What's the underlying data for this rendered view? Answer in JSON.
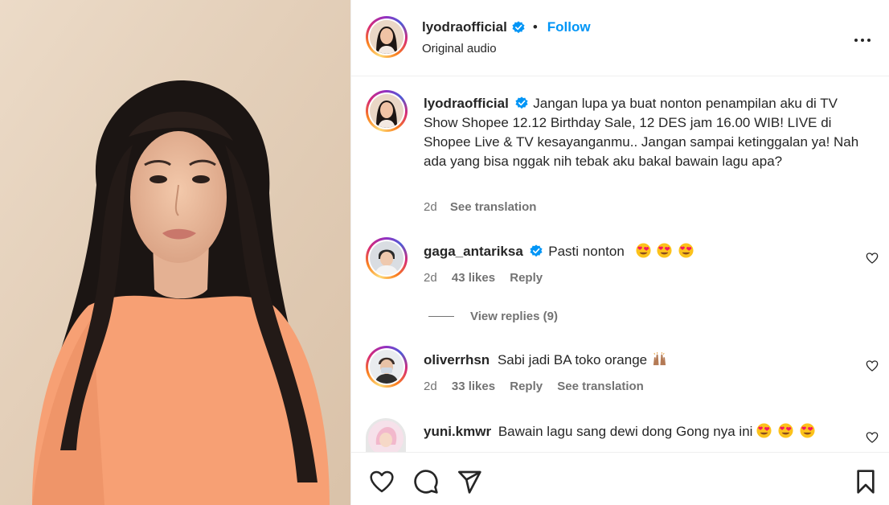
{
  "post": {
    "username": "lyodraofficial",
    "follow_label": "Follow",
    "separator": "•",
    "audio_label": "Original audio"
  },
  "caption": {
    "username": "lyodraofficial",
    "text": "Jangan lupa ya buat nonton penampilan aku di TV Show Shopee 12.12 Birthday Sale, 12 DES jam 16.00 WIB! LIVE di Shopee Live & TV kesayanganmu.. Jangan sampai ketinggalan ya! Nah ada yang bisa nggak nih tebak aku bakal bawain lagu apa?",
    "time": "2d",
    "translate": "See translation"
  },
  "comments": [
    {
      "username": "gaga_antariksa",
      "verified": true,
      "text": "Pasti nonton",
      "emoji": "heart-eyes x3",
      "time": "2d",
      "likes": "43 likes",
      "reply": "Reply",
      "view_replies": "View replies (9)"
    },
    {
      "username": "oliverrhsn",
      "verified": false,
      "text": "Sabi jadi BA toko orange",
      "emoji": "raising-hands",
      "time": "2d",
      "likes": "33 likes",
      "reply": "Reply",
      "translate": "See translation"
    },
    {
      "username": "yuni.kmwr",
      "verified": false,
      "text": "Bawain lagu sang dewi dong Gong nya ini",
      "emoji": "heart-eyes x3"
    }
  ],
  "icons": {
    "more": "more-options-icon",
    "like": "heart-icon",
    "comment": "comment-icon",
    "share": "share-icon",
    "save": "bookmark-icon"
  },
  "colors": {
    "accent": "#0095f6",
    "verified": "#0095f6",
    "muted": "#737373",
    "text": "#262626"
  }
}
